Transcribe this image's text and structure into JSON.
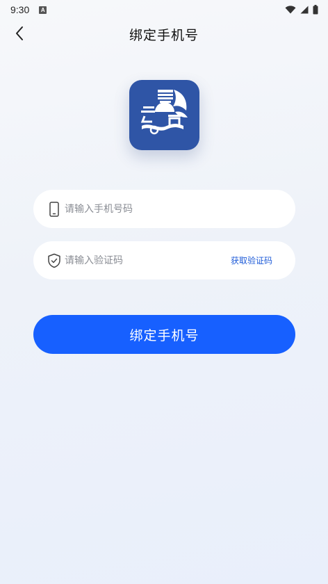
{
  "status_bar": {
    "time": "9:30",
    "notification_badge": "A"
  },
  "nav": {
    "title": "绑定手机号"
  },
  "phone_input": {
    "placeholder": "请输入手机号码",
    "value": ""
  },
  "code_input": {
    "placeholder": "请输入验证码",
    "value": ""
  },
  "get_code_label": "获取验证码",
  "submit_label": "绑定手机号",
  "colors": {
    "primary": "#1760ff",
    "link": "#1e5bd8",
    "logo_bg": "#2f55a6"
  },
  "icons": [
    "wifi-icon",
    "signal-icon",
    "battery-icon",
    "back-arrow-icon",
    "phone-icon",
    "shield-check-icon"
  ]
}
